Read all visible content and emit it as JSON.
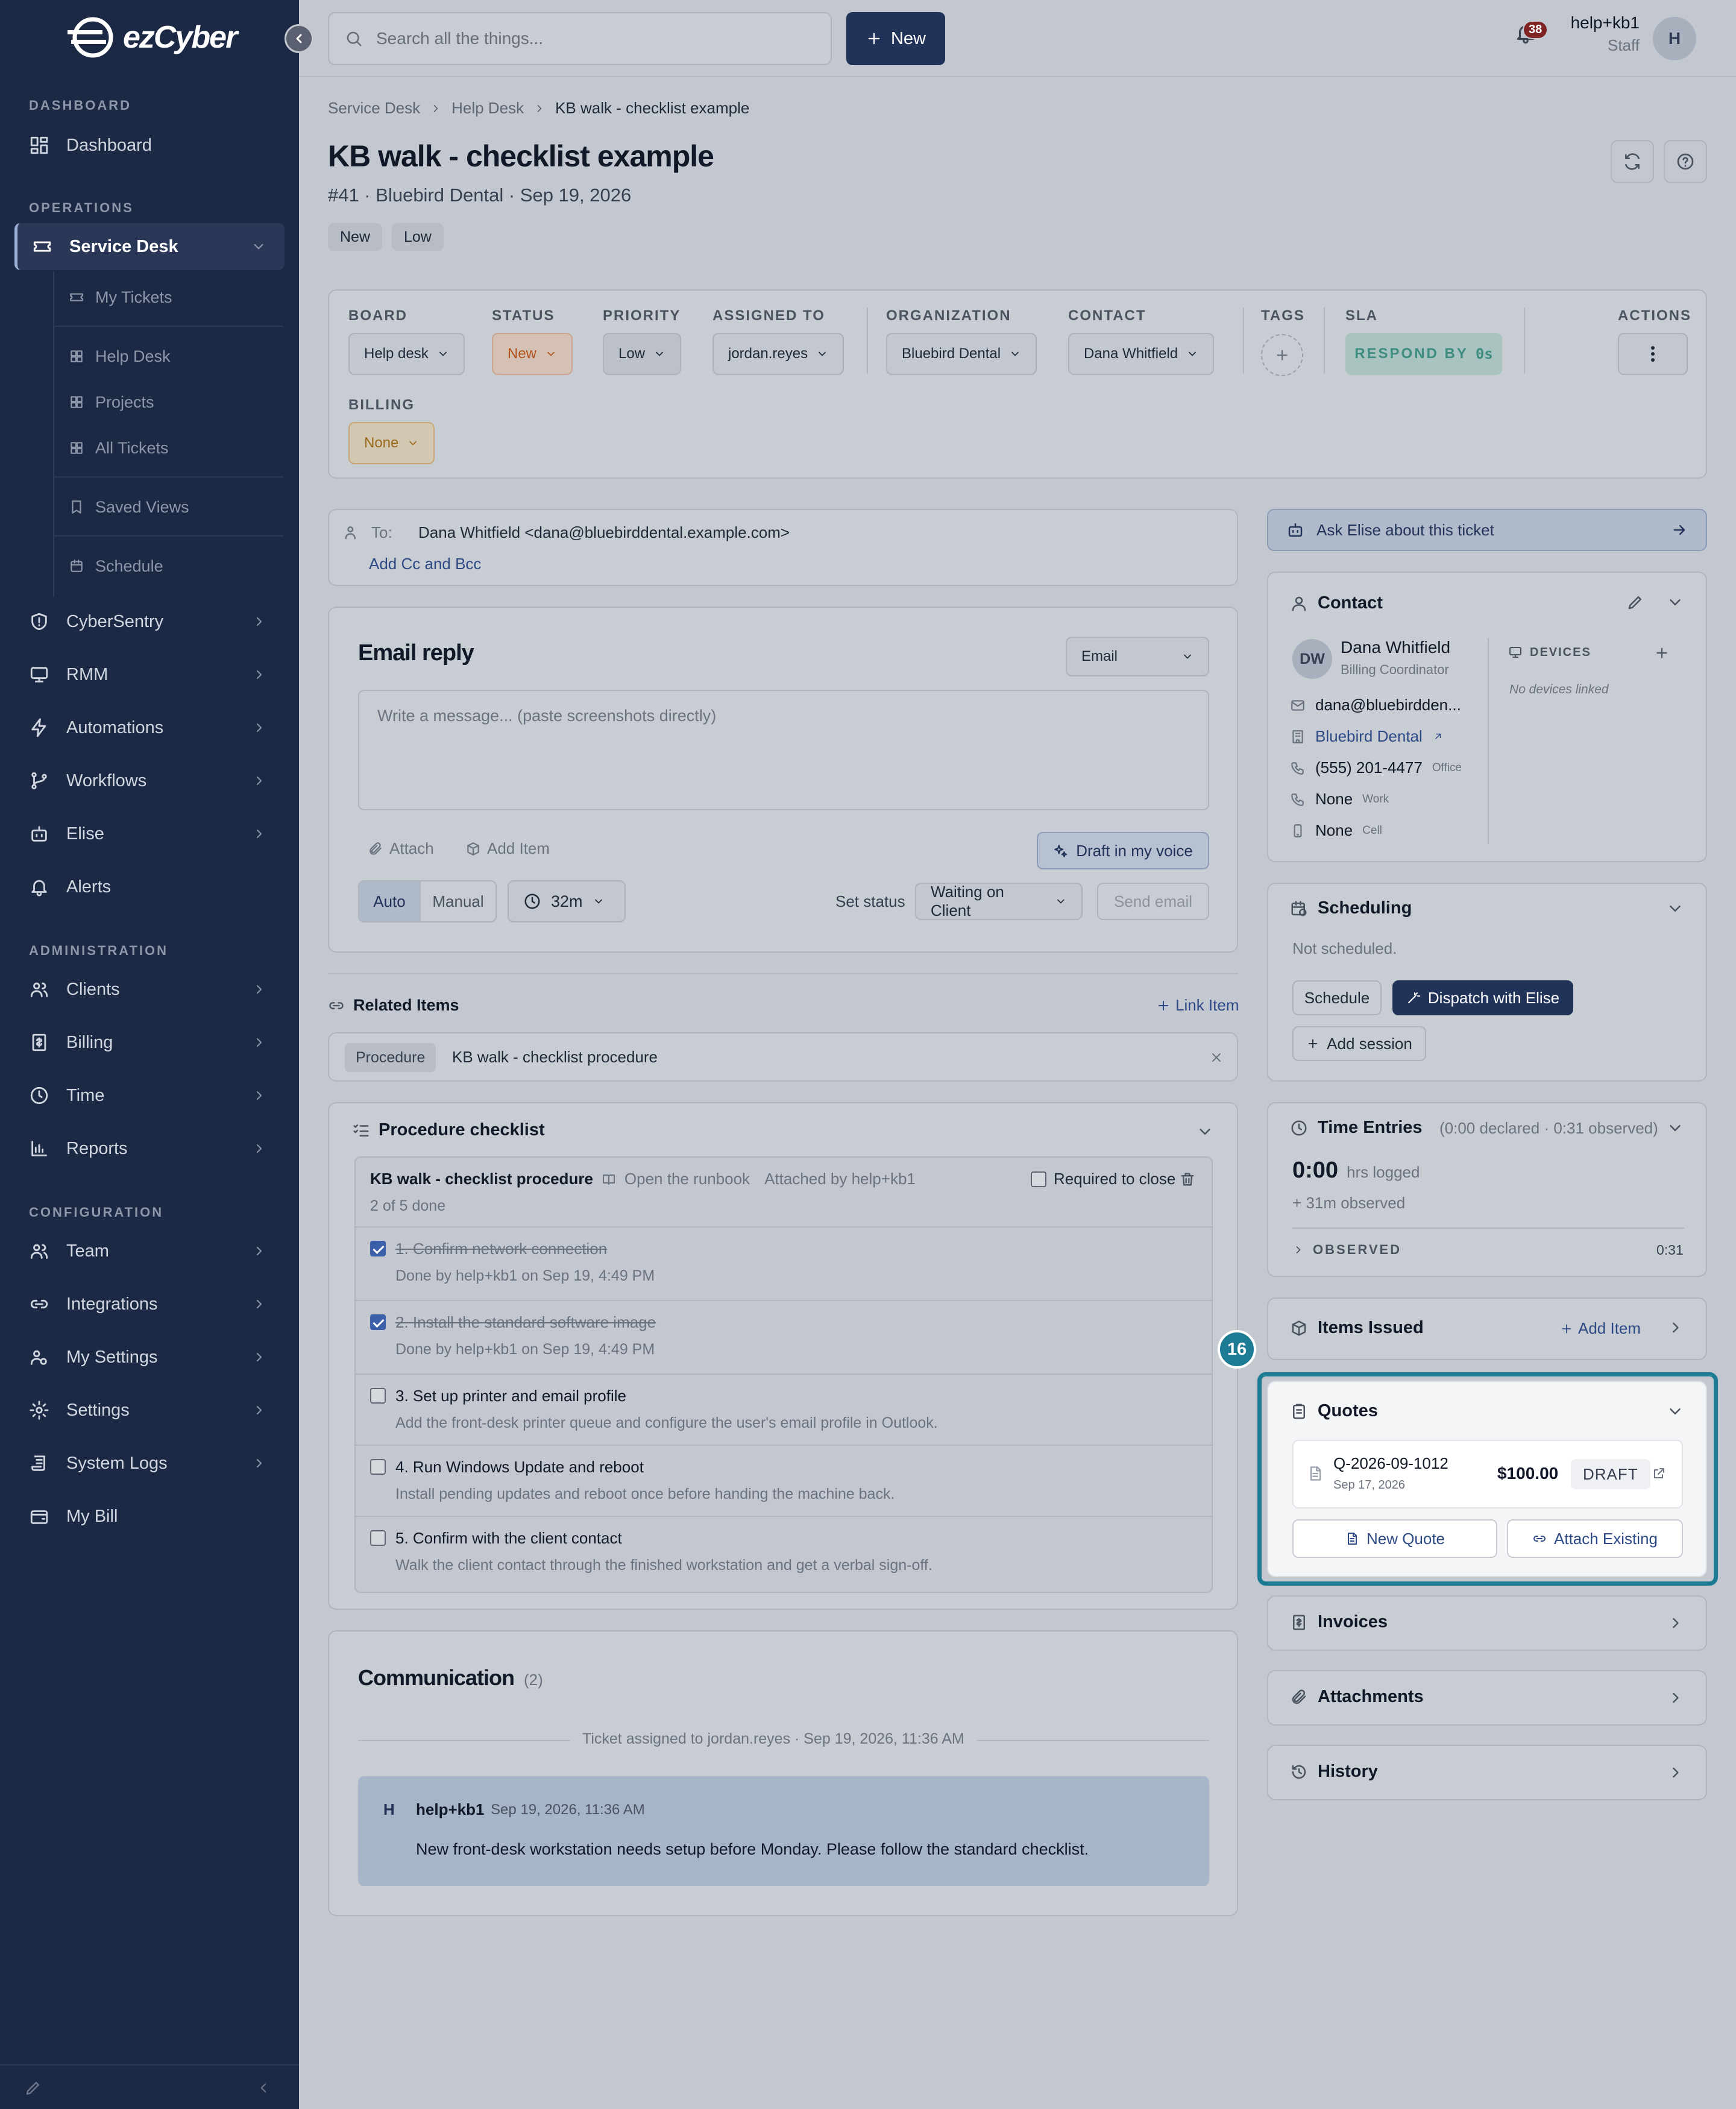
{
  "brand": {
    "logo_text": "ezCyber"
  },
  "sidebar": {
    "sections": {
      "dashboard": "DASHBOARD",
      "operations": "OPERATIONS",
      "administration": "ADMINISTRATION",
      "configuration": "CONFIGURATION"
    },
    "dashboard": "Dashboard",
    "service_desk": "Service Desk",
    "sub": [
      "My Tickets",
      "Help Desk",
      "Projects",
      "All Tickets",
      "Saved Views",
      "Schedule"
    ],
    "ops": [
      "CyberSentry",
      "RMM",
      "Automations",
      "Workflows",
      "Elise",
      "Alerts"
    ],
    "admin": [
      "Clients",
      "Billing",
      "Time",
      "Reports"
    ],
    "config": [
      "Team",
      "Integrations",
      "My Settings",
      "Settings",
      "System Logs",
      "My Bill"
    ]
  },
  "topbar": {
    "search_placeholder": "Search all the things...",
    "new_label": "New",
    "notif_count": "38",
    "user_name": "help+kb1",
    "user_role": "Staff",
    "avatar": "H"
  },
  "breadcrumb": [
    "Service Desk",
    "Help Desk",
    "KB walk - checklist example"
  ],
  "ticket": {
    "title": "KB walk - checklist example",
    "subtitle": "#41 · Bluebird Dental · Sep 19, 2026",
    "tags": [
      "New",
      "Low"
    ]
  },
  "fields": {
    "board": {
      "label": "BOARD",
      "value": "Help desk"
    },
    "status": {
      "label": "STATUS",
      "value": "New"
    },
    "priority": {
      "label": "PRIORITY",
      "value": "Low"
    },
    "assigned": {
      "label": "ASSIGNED TO",
      "value": "jordan.reyes"
    },
    "organization": {
      "label": "ORGANIZATION",
      "value": "Bluebird Dental"
    },
    "contact": {
      "label": "CONTACT",
      "value": "Dana Whitfield"
    },
    "tags": {
      "label": "TAGS"
    },
    "sla": {
      "label": "SLA",
      "value": "RESPOND BY",
      "time": "0s"
    },
    "actions": {
      "label": "ACTIONS"
    },
    "billing": {
      "label": "BILLING",
      "value": "None"
    }
  },
  "recipient": {
    "to_label": "To:",
    "to_value": "Dana Whitfield <dana@bluebirddental.example.com>",
    "cc_link": "Add Cc and Bcc"
  },
  "reply": {
    "title": "Email reply",
    "channel": "Email",
    "placeholder": "Write a message... (paste screenshots directly)",
    "attach": "Attach",
    "add_item": "Add Item",
    "draft": "Draft in my voice",
    "auto": "Auto",
    "manual": "Manual",
    "timer": "32m",
    "set_status_label": "Set status",
    "status_value": "Waiting on Client",
    "send": "Send email"
  },
  "related": {
    "title": "Related Items",
    "link_label": "Link Item",
    "item_type": "Procedure",
    "item_name": "KB walk - checklist procedure"
  },
  "checklist": {
    "title": "Procedure checklist",
    "procedure_name": "KB walk - checklist procedure",
    "runbook": "Open the runbook",
    "attached_by": "Attached by help+kb1",
    "required": "Required to close",
    "progress": "2 of 5 done",
    "items": [
      {
        "title": "1. Confirm network connection",
        "desc": "Done by help+kb1 on Sep 19, 4:49 PM",
        "done": true
      },
      {
        "title": "2. Install the standard software image",
        "desc": "Done by help+kb1 on Sep 19, 4:49 PM",
        "done": true
      },
      {
        "title": "3. Set up printer and email profile",
        "desc": "Add the front-desk printer queue and configure the user's email profile in Outlook.",
        "done": false
      },
      {
        "title": "4. Run Windows Update and reboot",
        "desc": "Install pending updates and reboot once before handing the machine back.",
        "done": false
      },
      {
        "title": "5. Confirm with the client contact",
        "desc": "Walk the client contact through the finished workstation and get a verbal sign-off.",
        "done": false
      }
    ]
  },
  "communication": {
    "title": "Communication",
    "count": "(2)",
    "event": "Ticket assigned to jordan.reyes · Sep 19, 2026, 11:36 AM",
    "msg_avatar": "H",
    "msg_author": "help+kb1",
    "msg_time": "Sep 19, 2026, 11:36 AM",
    "msg_body": "New front-desk workstation needs setup before Monday. Please follow the standard checklist."
  },
  "elise": {
    "label": "Ask Elise about this ticket"
  },
  "contact_card": {
    "title": "Contact",
    "initials": "DW",
    "name": "Dana Whitfield",
    "role": "Billing Coordinator",
    "email": "dana@bluebirdden...",
    "org": "Bluebird Dental",
    "phone": "(555) 201-4477",
    "phone_type": "Office",
    "work": "None",
    "work_type": "Work",
    "cell": "None",
    "cell_type": "Cell",
    "devices_label": "DEVICES",
    "devices_empty": "No devices linked"
  },
  "scheduling": {
    "title": "Scheduling",
    "status": "Not scheduled.",
    "schedule_btn": "Schedule",
    "dispatch_btn": "Dispatch with Elise",
    "add_session": "Add session"
  },
  "time": {
    "title": "Time Entries",
    "summary": "(0:00 declared · 0:31 observed)",
    "logged": "0:00",
    "logged_label": "hrs logged",
    "observed_note": "+ 31m observed",
    "observed_label": "OBSERVED",
    "observed_value": "0:31"
  },
  "items_issued": {
    "title": "Items Issued",
    "add_label": "Add Item"
  },
  "step_marker": "16",
  "quotes": {
    "title": "Quotes",
    "number": "Q-2026-09-1012",
    "date": "Sep 17, 2026",
    "amount": "$100.00",
    "status": "DRAFT",
    "new_btn": "New Quote",
    "attach_btn": "Attach Existing"
  },
  "invoices": {
    "title": "Invoices"
  },
  "attachments": {
    "title": "Attachments"
  },
  "history": {
    "title": "History"
  },
  "colors": {
    "sidebar": "#1c2945",
    "primary": "#22335a",
    "highlight": "#1e7b94",
    "sla": "#3e8d80"
  }
}
